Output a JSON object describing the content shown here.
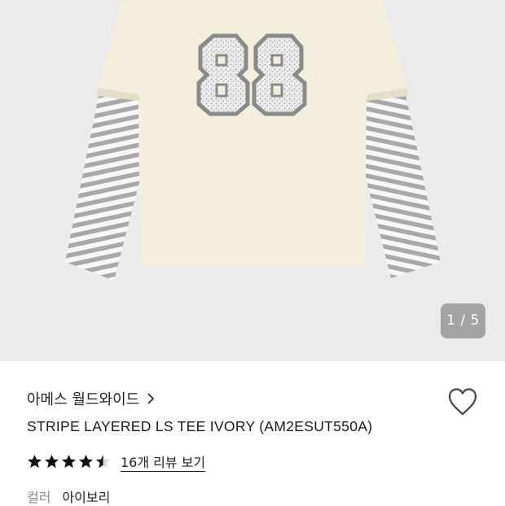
{
  "gallery": {
    "pager": "1 / 5",
    "image_icon": "long-sleeve-tee-88-graphic"
  },
  "product": {
    "brand": "아메스 월드와이드",
    "title": "STRIPE LAYERED LS TEE IVORY (AM2ESUT550A)",
    "rating": 4.5,
    "reviews_label": "16개 리뷰 보기",
    "option_label": "컬러",
    "option_value": "아이보리"
  },
  "icons": {
    "brand_arrow": "chevron-right-icon",
    "wishlist": "heart-outline-icon",
    "star": "star-icon"
  },
  "colors": {
    "gallery_bg": "#ebebeb",
    "tee_body": "#f3eedb",
    "stripe_gray": "#a7a7a7",
    "star": "#111111"
  }
}
